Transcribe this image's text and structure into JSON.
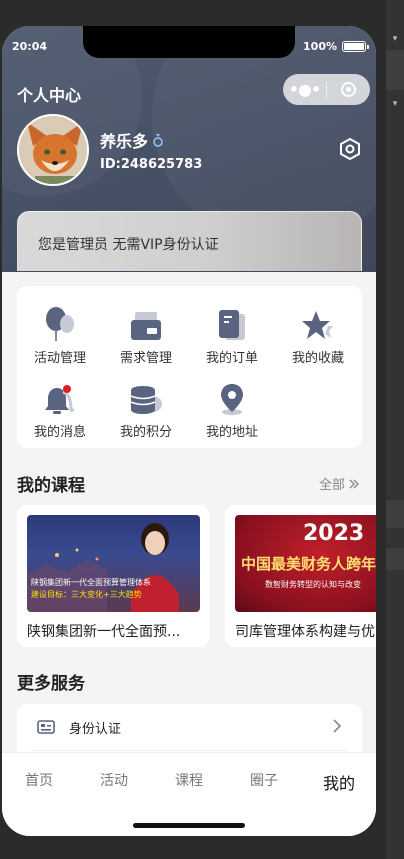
{
  "status": {
    "time": "20:04",
    "battery": "100%",
    "battery_level": 1.0
  },
  "header": {
    "title": "个人中心"
  },
  "user": {
    "name": "养乐多",
    "id": "ID:248625783"
  },
  "vip_banner": {
    "text": "您是管理员 无需VIP身份认证"
  },
  "menu": [
    {
      "label": "活动管理",
      "icon": "balloon-icon"
    },
    {
      "label": "需求管理",
      "icon": "card-icon"
    },
    {
      "label": "我的订单",
      "icon": "order-icon"
    },
    {
      "label": "我的收藏",
      "icon": "star-icon"
    },
    {
      "label": "我的消息",
      "icon": "bell-icon"
    },
    {
      "label": "我的积分",
      "icon": "coins-icon"
    },
    {
      "label": "我的地址",
      "icon": "location-pin-icon"
    }
  ],
  "courses": {
    "title": "我的课程",
    "more": "全部",
    "items": [
      {
        "name": "陕钢集团新一代全面预...",
        "thumb_line1": "陕钢集团新一代全面预算管理体系",
        "thumb_line2": "建设目标：三大变化+三大趋势"
      },
      {
        "name": "司库管理体系构建与优",
        "thumb_year": "2023",
        "thumb_title": "中国最美财务人跨年",
        "thumb_sub": "数智财务转型的认知与改变"
      }
    ]
  },
  "services": {
    "title": "更多服务",
    "items": [
      {
        "label": "身份认证",
        "icon": "id-card-icon"
      }
    ]
  },
  "tabbar": {
    "items": [
      {
        "label": "首页"
      },
      {
        "label": "活动"
      },
      {
        "label": "课程"
      },
      {
        "label": "圈子"
      },
      {
        "label": "我的",
        "active": true
      }
    ]
  }
}
